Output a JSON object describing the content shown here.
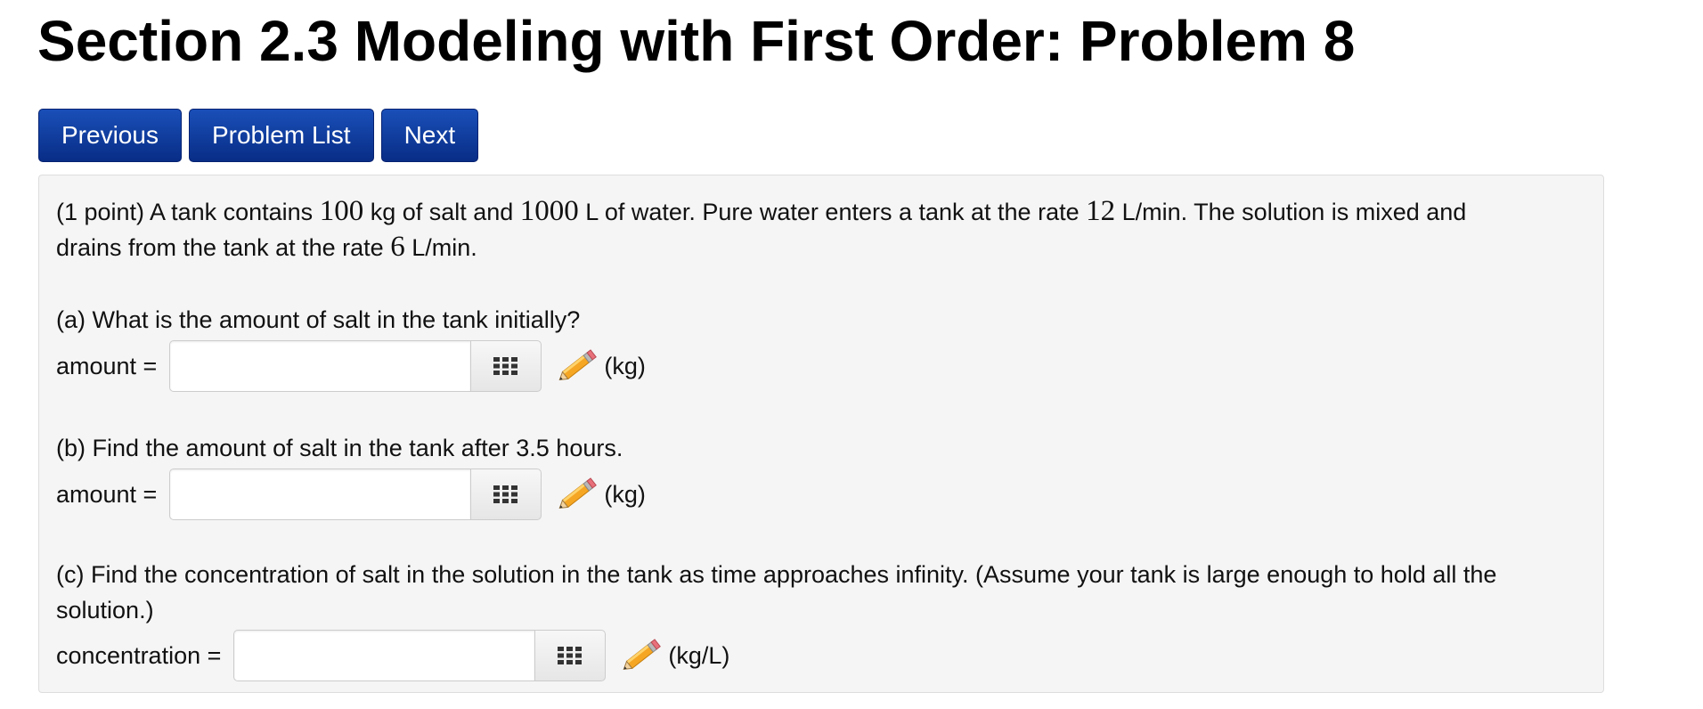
{
  "page": {
    "title": "Section 2.3 Modeling with First Order: Problem 8"
  },
  "nav": {
    "previous": "Previous",
    "problem_list": "Problem List",
    "next": "Next"
  },
  "problem": {
    "intro": {
      "t1": "(1 point) A tank contains ",
      "m1": "100",
      "t2": " kg of salt and ",
      "m2": "1000",
      "t3": " L of water. Pure water enters a tank at the rate ",
      "m3": "12",
      "t4": " L/min. The solution is mixed and",
      "t5": "drains from the tank at the rate ",
      "m4": "6",
      "t6": " L/min."
    },
    "part_a": {
      "question": "(a) What is the amount of salt in the tank initially?",
      "label": "amount =",
      "value": "",
      "unit": "(kg)"
    },
    "part_b": {
      "question": "(b) Find the amount of salt in the tank after 3.5 hours.",
      "label": "amount =",
      "value": "",
      "unit": "(kg)"
    },
    "part_c": {
      "question_line1": "(c) Find the concentration of salt in the solution in the tank as time approaches infinity. (Assume your tank is large enough to hold all the",
      "question_line2": "solution.)",
      "label": "concentration =",
      "value": "",
      "unit": "(kg/L)"
    }
  },
  "icons": {
    "keypad": "keypad-icon",
    "pencil": "pencil-icon"
  },
  "colors": {
    "nav_button_bg": "#0d3a9e",
    "panel_bg": "#f5f5f5"
  }
}
